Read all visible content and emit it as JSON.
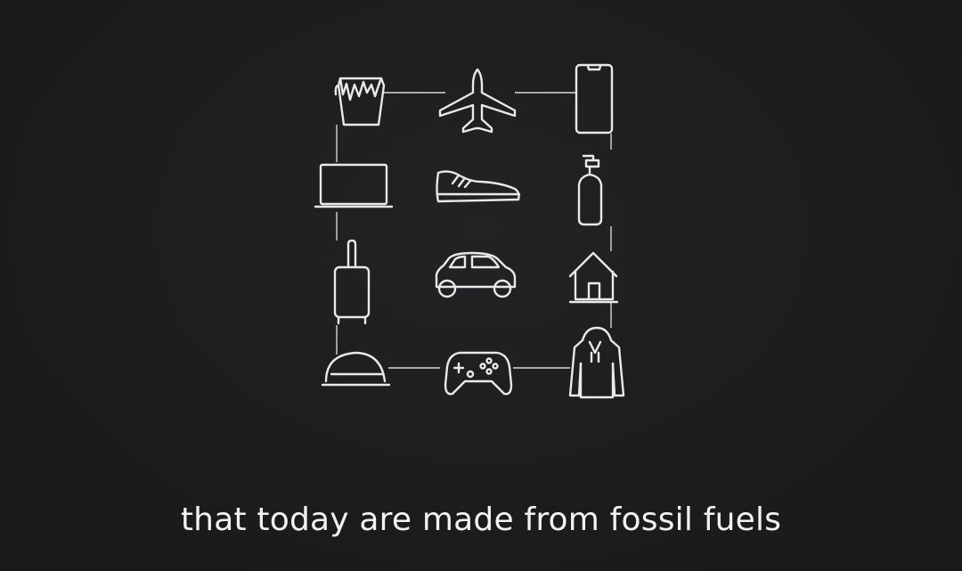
{
  "caption": "that today are made from fossil fuels",
  "colors": {
    "background": "#1d1d1f",
    "line": "#e9e9e9",
    "text": "#f2f2f2"
  },
  "icons": [
    "paint-bucket-icon",
    "airplane-icon",
    "smartphone-icon",
    "laptop-icon",
    "sneaker-icon",
    "pump-bottle-icon",
    "suitcase-icon",
    "car-icon",
    "house-icon",
    "hard-hat-icon",
    "game-controller-icon",
    "hoodie-icon"
  ]
}
